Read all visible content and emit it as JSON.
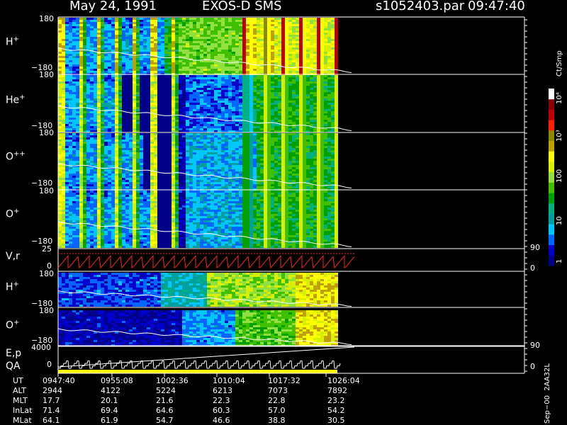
{
  "header": {
    "date": "May 24, 1991",
    "mission": "EXOS-D SMS",
    "file": "s1052403.par",
    "time": "09:47:40"
  },
  "colorbar": {
    "title": "Ct/Smp",
    "tick_labels": [
      "1",
      "10",
      "100",
      "10³",
      "10⁴"
    ],
    "colors": [
      "#00008b",
      "#0000cd",
      "#0066ff",
      "#00c8ff",
      "#00a0a0",
      "#00b080",
      "#00a000",
      "#40c000",
      "#90e040",
      "#d8f000",
      "#ffff00",
      "#c0a000",
      "#8b8b00",
      "#ff2000",
      "#c00000",
      "#8b0000",
      "#ffffff"
    ]
  },
  "panels": {
    "p1": {
      "name": "H",
      "sup": "+",
      "ytop": "180",
      "ybot": "−180"
    },
    "p2": {
      "name": "He",
      "sup": "+",
      "ytop": "180",
      "ybot": "−180"
    },
    "p3": {
      "name": "O",
      "sup": "++",
      "ytop": "180",
      "ybot": "−180"
    },
    "p4": {
      "name": "O",
      "sup": "+",
      "ytop": "180",
      "ybot": "−180"
    },
    "vr": {
      "name": "V,r",
      "ytop": "25",
      "ymid": "0",
      "right_top": "90",
      "right_bot": "0"
    },
    "p6": {
      "name": "H",
      "sup": "+",
      "ytop": "180",
      "ybot": "−180"
    },
    "p7": {
      "name": "O",
      "sup": "+",
      "ytop": "180",
      "ybot": "−180"
    },
    "ep": {
      "name1": "E,p",
      "name2": "QA",
      "ytop": "4000",
      "ymid": "0",
      "right_top": "90",
      "right_bot": "0"
    }
  },
  "footer_id": "Sep−00  2AA32L",
  "table": {
    "rows": [
      {
        "label": "UT",
        "values": [
          "0947:40",
          "0955:08",
          "1002:36",
          "1010:04",
          "1017:32",
          "1026:04"
        ]
      },
      {
        "label": "ALT",
        "values": [
          "2944",
          "4122",
          "5224",
          "6213",
          "7073",
          "7892"
        ]
      },
      {
        "label": "MLT",
        "values": [
          "17.7",
          "20.1",
          "21.6",
          "22.3",
          "22.8",
          "23.2"
        ]
      },
      {
        "label": "InLat",
        "values": [
          "71.4",
          "69.4",
          "64.6",
          "60.3",
          "57.0",
          "54.2"
        ]
      },
      {
        "label": "MLat",
        "values": [
          "64.1",
          "61.9",
          "54.7",
          "46.6",
          "38.8",
          "30.5"
        ]
      }
    ]
  },
  "chart_data": {
    "type": "heatmap",
    "title": "May 24, 1991   EXOS-D SMS",
    "x": {
      "tick_labels": [
        "0947:40",
        "0955:08",
        "1002:36",
        "1010:04",
        "1017:32",
        "1026:04"
      ],
      "data_end": "1024:20"
    },
    "pitch_angle_panels": {
      "species": [
        "H+",
        "He+",
        "O++",
        "O+"
      ],
      "ylim": [
        -180,
        180
      ]
    },
    "energy_angle_panels": {
      "species": [
        "H+",
        "O+"
      ],
      "ylim": [
        -180,
        180
      ]
    },
    "vr_panel": {
      "ylim": [
        0,
        25
      ],
      "right_axis": [
        0,
        90
      ]
    },
    "ep_panel": {
      "ylim": [
        0,
        4000
      ],
      "right_axis": [
        0,
        90
      ]
    },
    "color_scale": {
      "label": "Ct/Smp",
      "log": true,
      "range": [
        1,
        10000
      ]
    }
  }
}
